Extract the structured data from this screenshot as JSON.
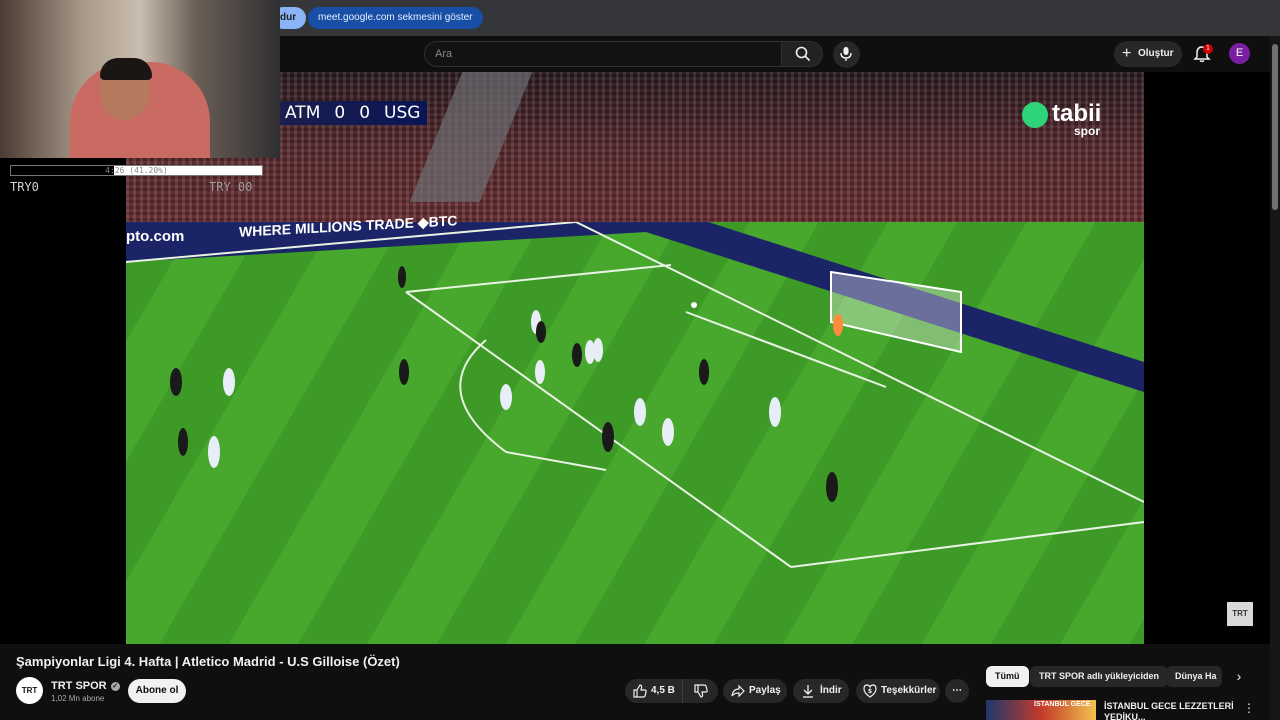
{
  "browser": {
    "share_pill_left": "dur",
    "share_pill": "meet.google.com sekmesini göster"
  },
  "header": {
    "search_placeholder": "Ara",
    "create_label": "Oluştur",
    "notification_count": "1",
    "avatar_letter": "E",
    "icons": [
      "search-icon",
      "mic-icon",
      "plus-icon",
      "bell-icon"
    ]
  },
  "overlay": {
    "progress_text": "4:26 (41.20%)",
    "progress_fraction": 0.412,
    "try_left": "TRY0",
    "try_right": "TRY 00"
  },
  "video": {
    "score_home": "ATM",
    "score_home_goals": "0",
    "score_away_goals": "0",
    "score_away": "USG",
    "broadcaster": "tabii",
    "broadcaster_sub": "spor",
    "ad_board_1": "pto.com",
    "ad_board_2": "WHERE MILLIONS TRADE ◆BTC",
    "channel_watermark": "TRT"
  },
  "meta": {
    "title": "Şampiyonlar Ligi 4. Hafta | Atletico Madrid - U.S Gilloise (Özet)",
    "channel_name": "TRT SPOR",
    "channel_avatar": "TRT",
    "subscribers": "1,02 Mn abone",
    "subscribe_label": "Abone ol"
  },
  "actions": {
    "likes": "4,5 B",
    "share": "Paylaş",
    "download": "İndir",
    "thanks": "Teşekkürler",
    "more": "⋯"
  },
  "chips": [
    "Tümü",
    "TRT SPOR adlı yükleyiciden",
    "Dünya Ha"
  ],
  "recommendation": {
    "thumb_text": "İSTANBUL GECE",
    "title": "İSTANBUL GECE LEZZETLERİ YEDİKU..."
  },
  "colors": {
    "accent_blue": "#8ab4f8",
    "share_blue": "#174ea6",
    "badge_red": "#cc0000",
    "avatar_purple": "#7b1fa2",
    "tabii_green": "#2ed47a"
  }
}
